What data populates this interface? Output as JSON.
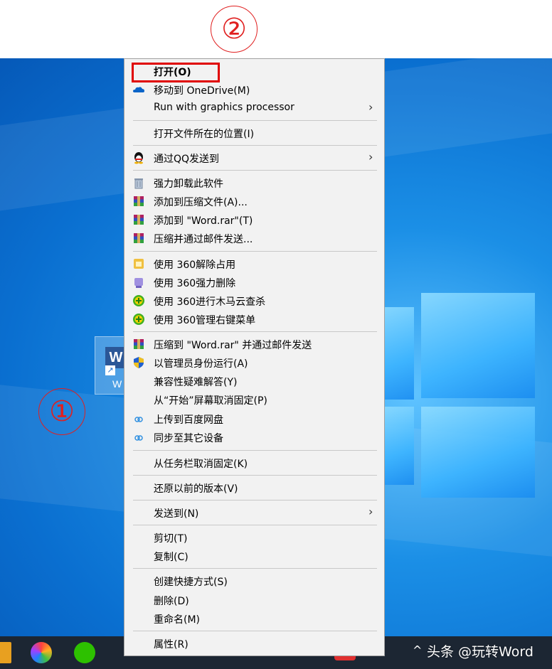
{
  "annotations": {
    "step1": "①",
    "step2": "②"
  },
  "desktop": {
    "file_label": "W",
    "icon_letter": "W",
    "shortcut_glyph": "↗"
  },
  "context_menu": {
    "open": "打开(O)",
    "move_onedrive": "移动到 OneDrive(M)",
    "run_gpu": "Run with graphics processor",
    "open_location": "打开文件所在的位置(I)",
    "send_qq": "通过QQ发送到",
    "uninstall": "强力卸载此软件",
    "add_archive": "添加到压缩文件(A)...",
    "add_word_rar": "添加到 \"Word.rar\"(T)",
    "compress_email": "压缩并通过邮件发送...",
    "u360_unlock": "使用 360解除占用",
    "u360_delete": "使用 360强力删除",
    "u360_scan": "使用 360进行木马云查杀",
    "u360_menu": "使用 360管理右键菜单",
    "compress_word_email": "压缩到 \"Word.rar\" 并通过邮件发送",
    "run_admin": "以管理员身份运行(A)",
    "compat": "兼容性疑难解答(Y)",
    "unpin_start": "从“开始”屏幕取消固定(P)",
    "upload_baidu": "上传到百度网盘",
    "sync_devices": "同步至其它设备",
    "unpin_taskbar": "从任务栏取消固定(K)",
    "restore": "还原以前的版本(V)",
    "send_to": "发送到(N)",
    "cut": "剪切(T)",
    "copy": "复制(C)",
    "shortcut": "创建快捷方式(S)",
    "delete": "删除(D)",
    "rename": "重命名(M)",
    "properties": "属性(R)"
  },
  "taskbar": {
    "watermark": "头条 @玩转Word",
    "tray": "^"
  },
  "colors": {
    "highlight": "#e00000",
    "desktop": "#0a6fd0",
    "menu_bg": "#f2f2f2"
  }
}
